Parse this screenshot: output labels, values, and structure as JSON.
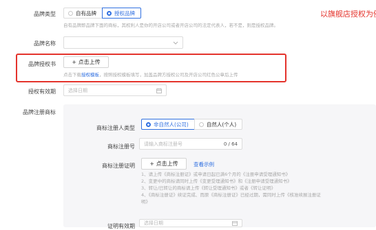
{
  "annotation": "以旗舰店授权为例",
  "brand_type": {
    "label": "品牌类型",
    "options": [
      "自有品牌",
      "授权品牌"
    ],
    "selected": "授权品牌",
    "hint": "自有品牌即品牌下面的商标，其权利人是你的开店公司或者开店公司的法定代表人，若不是，则是授权品牌。"
  },
  "brand_name": {
    "label": "品牌名称",
    "value": ""
  },
  "authorization": {
    "label": "品牌授权书",
    "upload_label": "+ 点击上传",
    "hint_prefix": "点击下载",
    "hint_link": "授权模板",
    "hint_suffix": "，按照授权模板填写，加盖品牌方授权公司及开店公司红色公章后上传"
  },
  "validity": {
    "label": "授权有效期",
    "placeholder": "选择日期"
  },
  "trademark": {
    "label": "品牌注册商标",
    "owner_type": {
      "label": "商标注册人类型",
      "options": [
        "非自然人(公司)",
        "自然人(个人)"
      ],
      "selected": "非自然人(公司)"
    },
    "reg_no": {
      "label": "商标注册号",
      "placeholder": "请输入商标注册号",
      "counter": "0 / 64"
    },
    "certificate": {
      "label": "商标注册证明",
      "upload_label": "+ 点击上传",
      "example_link": "查看示例",
      "notes": [
        "1、请上传《商标注册证》或申请日起已满6个月的《注册申请受理通知书》",
        "2、变更中的商标请同时上传《变更受理通知书》和《注册申请受理通知书》",
        "3、转让/已转让的商标请上传《转让受理通知书》或者《转让证明》",
        "4、《商标注册证》续证完成、而原《商标注册证》已经过期，需同时上传《核准续展注册证",
        "明》"
      ]
    },
    "cert_validity": {
      "label": "证明有效期",
      "placeholder": "选择日期"
    }
  }
}
